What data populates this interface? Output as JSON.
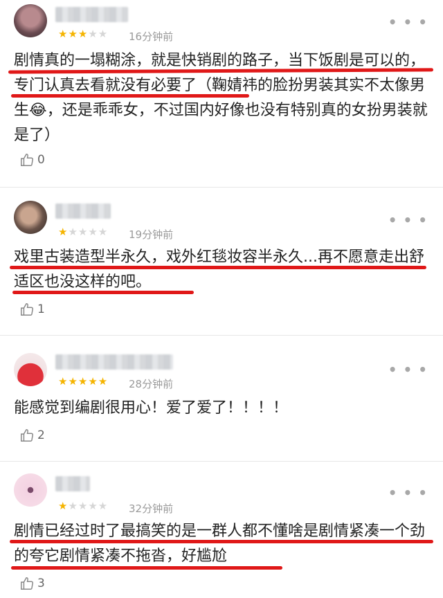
{
  "comments": [
    {
      "stars": "★★★★★",
      "rating": 3,
      "time": "16分钟前",
      "text": "剧情真的一塌糊涂，就是快销剧的路子，当下饭剧是可以的，专门认真去看就没有必要了（鞠婧祎的脸扮男装其实不太像男生😂，还是乖乖女，不过国内好像也没有特别真的女扮男装就是了）",
      "likes": "0",
      "more_icon": "more-icon"
    },
    {
      "stars": "★★★★★",
      "rating": 1,
      "time": "19分钟前",
      "text": "戏里古装造型半永久，戏外红毯妆容半永久...再不愿意走出舒适区也没这样的吧。",
      "likes": "1",
      "more_icon": "more-icon"
    },
    {
      "stars": "★★★★★",
      "rating": 5,
      "time": "28分钟前",
      "text": "能感觉到编剧很用心！爱了爱了！！！！",
      "likes": "2",
      "more_icon": "more-icon"
    },
    {
      "stars": "★★★★★",
      "rating": 1,
      "time": "32分钟前",
      "text": "剧情已经过时了最搞笑的是一群人都不懂啥是剧情紧凑一个劲的夸它剧情紧凑不拖沓，好尴尬",
      "likes": "3",
      "more_icon": "more-icon"
    }
  ],
  "colors": {
    "star_on": "#f5b400",
    "star_off": "#d6d6d6",
    "underline": "#e01818"
  }
}
